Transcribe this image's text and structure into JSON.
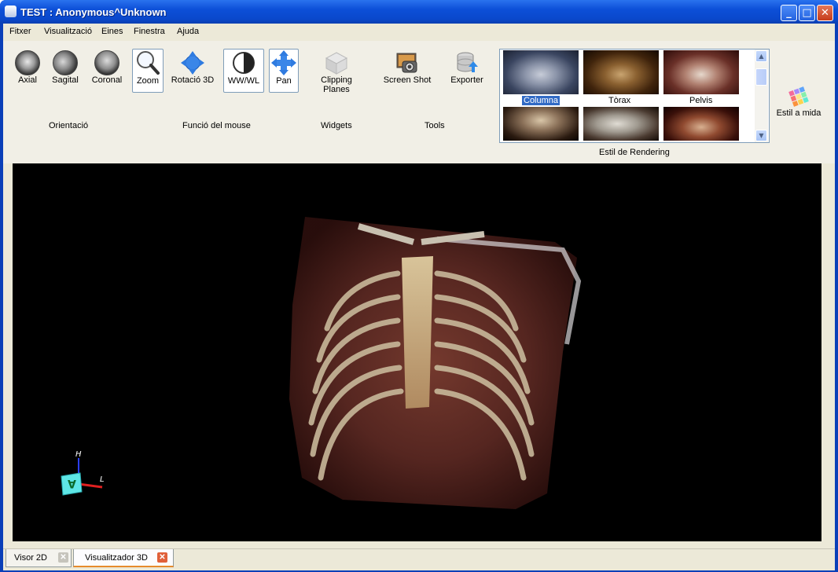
{
  "window": {
    "title": "TEST : Anonymous^Unknown"
  },
  "menu": [
    "Fitxer",
    "Visualització",
    "Eines",
    "Finestra",
    "Ajuda"
  ],
  "toolbar": {
    "orientation": {
      "label": "Orientació",
      "axial": "Axial",
      "sagital": "Sagital",
      "coronal": "Coronal"
    },
    "mouse": {
      "label": "Funció del mouse",
      "zoom": "Zoom",
      "rotate": "Rotació 3D",
      "wwwl": "WW/WL",
      "pan": "Pan"
    },
    "widgets": {
      "label": "Widgets",
      "clipping": "Clipping Planes"
    },
    "tools": {
      "label": "Tools",
      "screenshot": "Screen Shot",
      "exporter": "Exporter"
    },
    "rendering": {
      "label": "Estil de Rendering",
      "styles": [
        "Columna",
        "Tòrax",
        "Pelvis"
      ],
      "selected": "Columna"
    },
    "custom_style": "Estil a mida"
  },
  "orientation_marker": {
    "h": "H",
    "l": "L",
    "face": "A"
  },
  "tabs": [
    {
      "label": "Visor 2D",
      "active": false
    },
    {
      "label": "Visualitzador 3D",
      "active": true
    }
  ],
  "colors": {
    "titlebar": "#0c4fd8",
    "selection": "#316ac5",
    "tab_accent": "#e68b2c",
    "viewport_bg": "#000000"
  }
}
